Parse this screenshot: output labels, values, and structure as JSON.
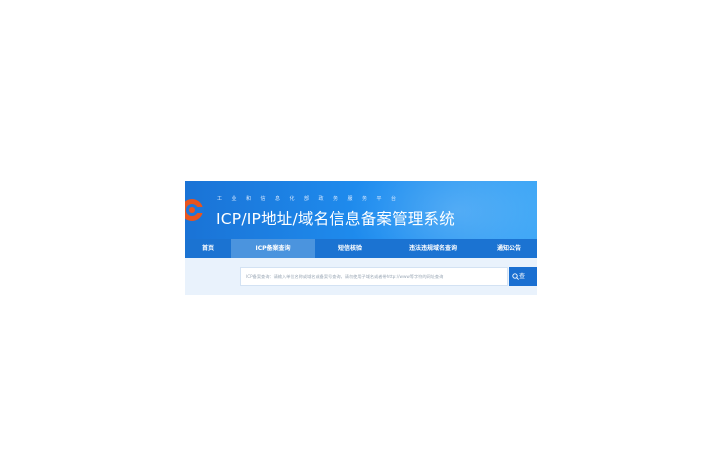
{
  "header": {
    "subtitle": "工业和信息化部政务服务平台",
    "title": "ICP/IP地址/域名信息备案管理系统"
  },
  "nav": {
    "items": [
      {
        "label": "首页",
        "active": false
      },
      {
        "label": "ICP备案查询",
        "active": true
      },
      {
        "label": "短信核验",
        "active": false
      },
      {
        "label": "违法违规域名查询",
        "active": false
      },
      {
        "label": "通知公告",
        "active": false
      }
    ]
  },
  "search": {
    "placeholder": "ICP备案查询：请输入单位名称或域名或备案号查询，请勿使用子域名或者带http://www等字符的网址查询",
    "button_label": "查"
  },
  "colors": {
    "banner": "#1f8ef0",
    "nav": "#1b73d2",
    "nav_active": "#4b94de",
    "search_bg": "#e9f2fc",
    "logo_orange": "#e8541e"
  },
  "icons": {
    "logo": "emblem-icon",
    "search": "search-icon"
  }
}
